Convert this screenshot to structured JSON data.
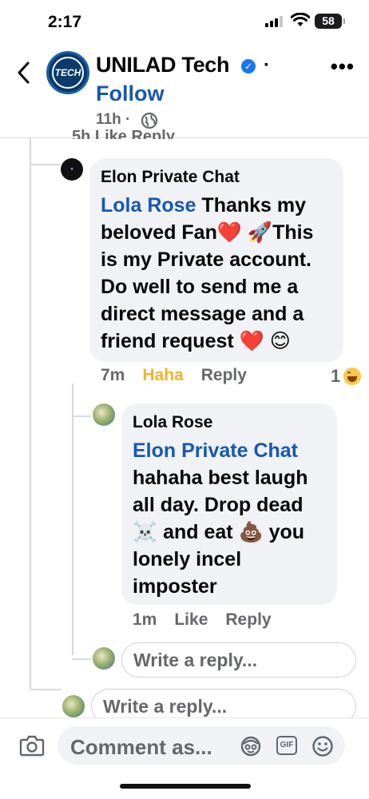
{
  "status_bar": {
    "time": "2:17",
    "battery": "58"
  },
  "header": {
    "page_name": "UNILAD Tech",
    "avatar_text": "TECH",
    "follow_label": "Follow",
    "post_time": "11h ·",
    "separator": "·"
  },
  "cutoff_row": {
    "text": "5h   Like   Reply"
  },
  "comments": [
    {
      "author": "Elon Private Chat",
      "mention": "Lola Rose",
      "text": " Thanks my beloved Fan❤️ 🚀This is my Private account. Do well to send me a direct message and a friend request ❤️ 😊",
      "time": "7m",
      "reaction_label": "Haha",
      "reply_label": "Reply",
      "reaction_count": "1"
    },
    {
      "author": "Lola Rose",
      "mention": "Elon Private Chat",
      "text": "hahaha best laugh all day. Drop dead ☠️ and eat 💩 you lonely incel imposter",
      "time": "1m",
      "like_label": "Like",
      "reply_label": "Reply"
    }
  ],
  "reply_inputs": [
    {
      "placeholder": "Write a reply..."
    },
    {
      "placeholder": "Write a reply..."
    }
  ],
  "composer": {
    "placeholder": "Comment as..."
  },
  "icons": [
    "back-icon",
    "verified-icon",
    "more-icon",
    "globe-icon",
    "camera-icon",
    "avatar-sticker-icon",
    "gif-icon",
    "emoji-icon"
  ],
  "colors": {
    "link": "#1558b0",
    "haha": "#f7b125",
    "bubble": "#f0f2f5",
    "verified": "#1877f2"
  }
}
